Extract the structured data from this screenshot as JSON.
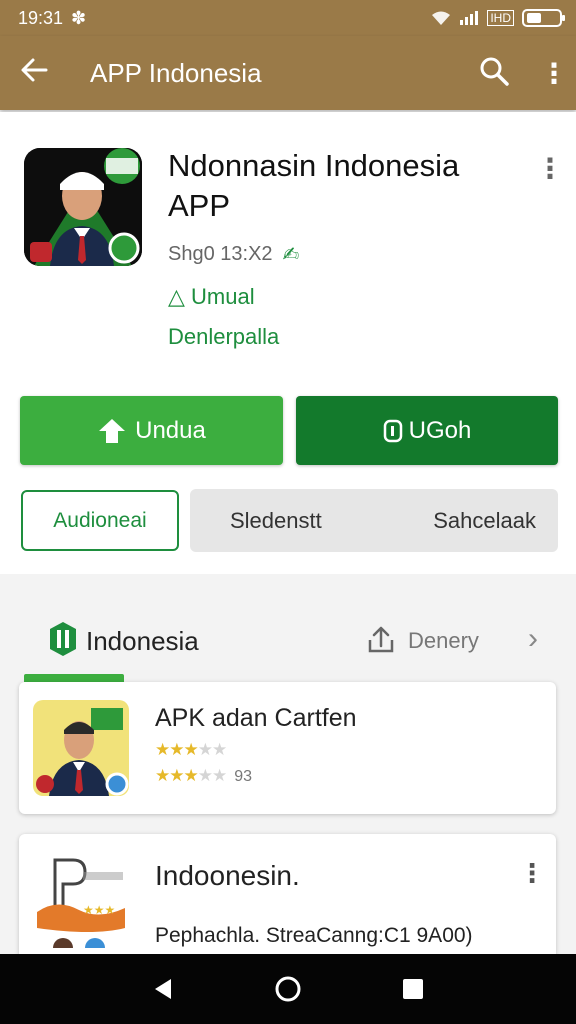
{
  "status_bar": {
    "time": "19:31",
    "right_text": "IHD"
  },
  "app_bar": {
    "title": "APP Indonesia"
  },
  "app": {
    "title": "Ndonnasin Indonesia APP",
    "meta": "Shg0 13:X2",
    "category": "Umual",
    "developer": "Denlerpalla"
  },
  "buttons": {
    "install": "Undua",
    "open": "UGoh"
  },
  "tabs": {
    "active": "Audioneai",
    "second": "Sledenstt",
    "third": "Sahcelaak"
  },
  "section": {
    "title": "Indonesia",
    "action": "Denery"
  },
  "list": [
    {
      "title": "APK adan Cartfen",
      "rating_count": "93"
    },
    {
      "title": "Indoonesin.",
      "description": "Pephachla. StreaCanng:C1 9A00)"
    }
  ],
  "colors": {
    "brand_bar": "#9a7a48",
    "green": "#3cae3f",
    "dark_green": "#137a2c",
    "accent_text": "#1e8e3e"
  }
}
